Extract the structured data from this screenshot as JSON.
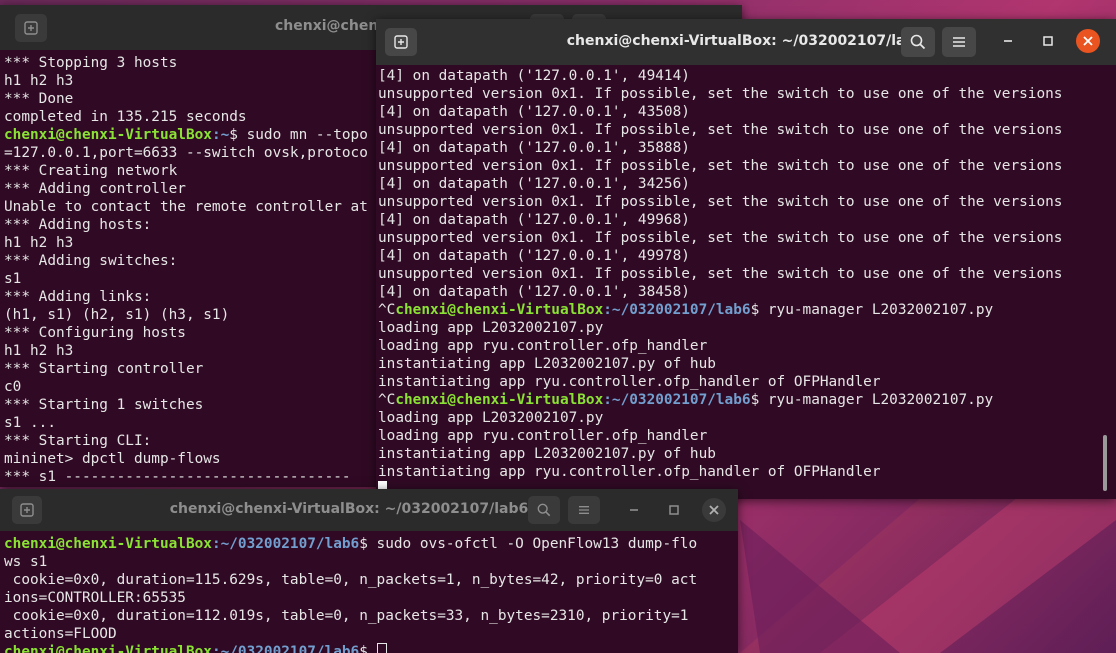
{
  "colors": {
    "terminal_bg": "#300a24",
    "user_host": "#8ae234",
    "path": "#729fcf",
    "close_active": "#e95420"
  },
  "icons": {
    "new_tab": "new-tab-icon",
    "search": "search-icon",
    "menu": "hamburger-menu-icon",
    "minimize": "minimize-icon",
    "maximize": "maximize-icon",
    "close": "close-icon"
  },
  "left_terminal": {
    "title": "chenxi@chenxi-",
    "lines": [
      {
        "text": "*** Stopping 3 hosts"
      },
      {
        "text": "h1 h2 h3"
      },
      {
        "text": "*** Done"
      },
      {
        "text": "completed in 135.215 seconds"
      },
      {
        "user": "chenxi@chenxi-VirtualBox",
        "path": ":~",
        "cmd": "$ sudo mn --topo"
      },
      {
        "text": "=127.0.0.1,port=6633 --switch ovsk,protoco"
      },
      {
        "text": "*** Creating network"
      },
      {
        "text": "*** Adding controller"
      },
      {
        "text": "Unable to contact the remote controller at"
      },
      {
        "text": "*** Adding hosts:"
      },
      {
        "text": "h1 h2 h3"
      },
      {
        "text": "*** Adding switches:"
      },
      {
        "text": "s1"
      },
      {
        "text": "*** Adding links:"
      },
      {
        "text": "(h1, s1) (h2, s1) (h3, s1)"
      },
      {
        "text": "*** Configuring hosts"
      },
      {
        "text": "h1 h2 h3"
      },
      {
        "text": "*** Starting controller"
      },
      {
        "text": "c0"
      },
      {
        "text": "*** Starting 1 switches"
      },
      {
        "text": "s1 ..."
      },
      {
        "text": "*** Starting CLI:"
      },
      {
        "text": "mininet> dpctl dump-flows"
      },
      {
        "text": "*** s1 ---------------------------------"
      }
    ]
  },
  "right_terminal": {
    "title": "chenxi@chenxi-VirtualBox: ~/032002107/lab6",
    "lines": [
      {
        "text": "[4] on datapath ('127.0.0.1', 49414)"
      },
      {
        "text": "unsupported version 0x1. If possible, set the switch to use one of the versions"
      },
      {
        "text": "[4] on datapath ('127.0.0.1', 43508)"
      },
      {
        "text": "unsupported version 0x1. If possible, set the switch to use one of the versions"
      },
      {
        "text": "[4] on datapath ('127.0.0.1', 35888)"
      },
      {
        "text": "unsupported version 0x1. If possible, set the switch to use one of the versions"
      },
      {
        "text": "[4] on datapath ('127.0.0.1', 34256)"
      },
      {
        "text": "unsupported version 0x1. If possible, set the switch to use one of the versions"
      },
      {
        "text": "[4] on datapath ('127.0.0.1', 49968)"
      },
      {
        "text": "unsupported version 0x1. If possible, set the switch to use one of the versions"
      },
      {
        "text": "[4] on datapath ('127.0.0.1', 49978)"
      },
      {
        "text": "unsupported version 0x1. If possible, set the switch to use one of the versions"
      },
      {
        "text": "[4] on datapath ('127.0.0.1', 38458)"
      },
      {
        "pre": "^C",
        "user": "chenxi@chenxi-VirtualBox",
        "path": ":~/032002107/lab6",
        "cmd": "$ ryu-manager L2032002107.py"
      },
      {
        "text": "loading app L2032002107.py"
      },
      {
        "text": "loading app ryu.controller.ofp_handler"
      },
      {
        "text": "instantiating app L2032002107.py of hub"
      },
      {
        "text": "instantiating app ryu.controller.ofp_handler of OFPHandler"
      },
      {
        "pre": "^C",
        "user": "chenxi@chenxi-VirtualBox",
        "path": ":~/032002107/lab6",
        "cmd": "$ ryu-manager L2032002107.py"
      },
      {
        "text": "loading app L2032002107.py"
      },
      {
        "text": "loading app ryu.controller.ofp_handler"
      },
      {
        "text": "instantiating app L2032002107.py of hub"
      },
      {
        "text": "instantiating app ryu.controller.ofp_handler of OFPHandler"
      }
    ]
  },
  "bottom_terminal": {
    "title": "chenxi@chenxi-VirtualBox: ~/032002107/lab6",
    "lines": [
      {
        "user": "chenxi@chenxi-VirtualBox",
        "path": ":~/032002107/lab6",
        "cmd": "$ sudo ovs-ofctl -O OpenFlow13 dump-flo"
      },
      {
        "text": "ws s1"
      },
      {
        "text": " cookie=0x0, duration=115.629s, table=0, n_packets=1, n_bytes=42, priority=0 act"
      },
      {
        "text": "ions=CONTROLLER:65535"
      },
      {
        "text": " cookie=0x0, duration=112.019s, table=0, n_packets=33, n_bytes=2310, priority=1"
      },
      {
        "text": "actions=FLOOD"
      },
      {
        "user": "chenxi@chenxi-VirtualBox",
        "path": ":~/032002107/lab6",
        "cmd": "$ "
      }
    ]
  }
}
